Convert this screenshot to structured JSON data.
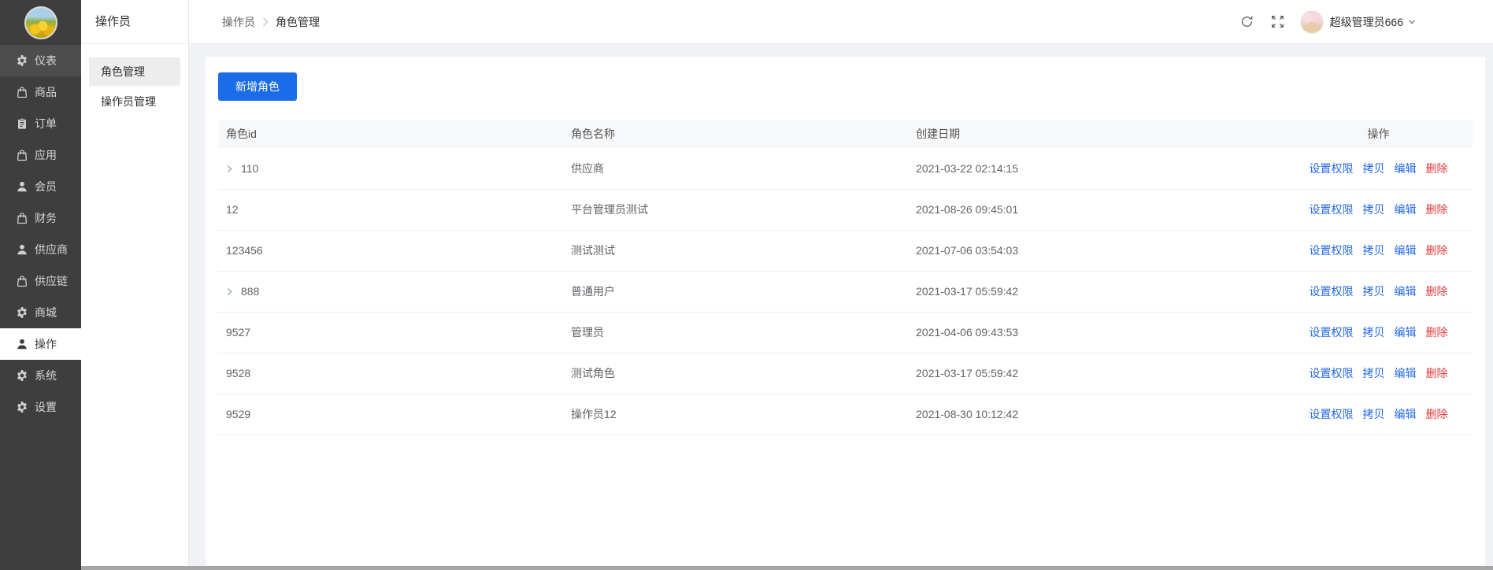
{
  "colors": {
    "accent_blue": "#1b6ce8",
    "danger_red": "#e23c3c",
    "sidebar_bg": "#3e3e3e",
    "page_bg": "#f0f2f5"
  },
  "sidebar": {
    "active_index": 9,
    "items": [
      {
        "label": "仪表",
        "icon": "gauge-gear-icon"
      },
      {
        "label": "商品",
        "icon": "bag-icon"
      },
      {
        "label": "订单",
        "icon": "order-clipboard-icon"
      },
      {
        "label": "应用",
        "icon": "bag-icon"
      },
      {
        "label": "会员",
        "icon": "user-icon"
      },
      {
        "label": "财务",
        "icon": "bag-icon"
      },
      {
        "label": "供应商",
        "icon": "user-icon"
      },
      {
        "label": "供应链",
        "icon": "bag-icon"
      },
      {
        "label": "商城",
        "icon": "gear-icon"
      },
      {
        "label": "操作",
        "icon": "user-icon"
      },
      {
        "label": "系统",
        "icon": "gear-icon"
      },
      {
        "label": "设置",
        "icon": "gear-icon"
      }
    ]
  },
  "submenu": {
    "title": "操作员",
    "active_index": 0,
    "items": [
      {
        "label": "角色管理"
      },
      {
        "label": "操作员管理"
      }
    ]
  },
  "topbar": {
    "breadcrumb": {
      "parent": "操作员",
      "current": "角色管理"
    },
    "user_name": "超级管理员666"
  },
  "main": {
    "add_button": "新增角色",
    "table": {
      "columns": {
        "id": "角色id",
        "name": "角色名称",
        "created": "创建日期",
        "ops": "操作"
      },
      "actions": [
        "设置权限",
        "拷贝",
        "编辑",
        "删除"
      ],
      "rows": [
        {
          "id": "110",
          "name": "供应商",
          "created": "2021-03-22 02:14:15",
          "expandable": true
        },
        {
          "id": "12",
          "name": "平台管理员测试",
          "created": "2021-08-26 09:45:01",
          "expandable": false
        },
        {
          "id": "123456",
          "name": "测试测试",
          "created": "2021-07-06 03:54:03",
          "expandable": false
        },
        {
          "id": "888",
          "name": "普通用户",
          "created": "2021-03-17 05:59:42",
          "expandable": true
        },
        {
          "id": "9527",
          "name": "管理员",
          "created": "2021-04-06 09:43:53",
          "expandable": false
        },
        {
          "id": "9528",
          "name": "测试角色",
          "created": "2021-03-17 05:59:42",
          "expandable": false
        },
        {
          "id": "9529",
          "name": "操作员12",
          "created": "2021-08-30 10:12:42",
          "expandable": false
        }
      ]
    }
  }
}
